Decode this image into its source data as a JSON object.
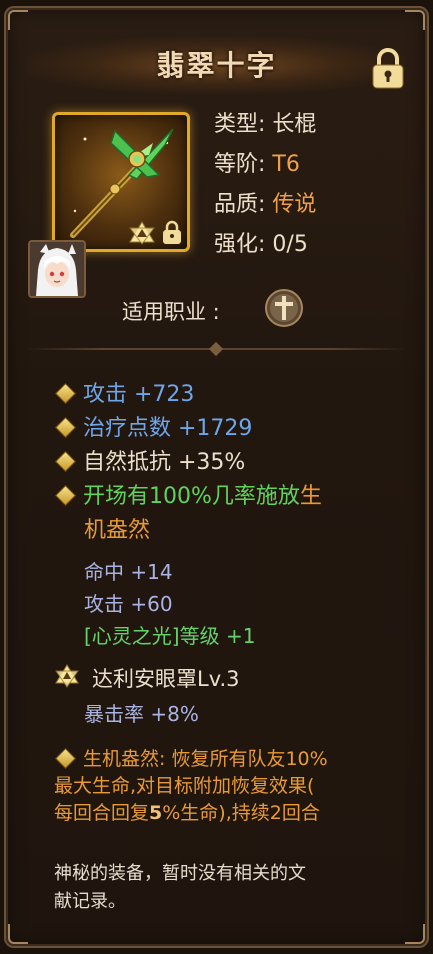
{
  "item": {
    "name": "翡翠十字",
    "type_label": "类型:",
    "type_value": "长棍",
    "tier_label": "等阶:",
    "tier_value": "T6",
    "quality_label": "品质:",
    "quality_value": "传说",
    "enhance_label": "强化:",
    "enhance_value": "0/5",
    "class_label": "适用职业 :",
    "class_icon": "priest-cross-icon"
  },
  "stats": {
    "attack": "攻击 +723",
    "heal_points": "治疗点数 +1729",
    "nature_resist": "自然抵抗 +35%",
    "proc_line1_prefix": "开场有100%几率施放",
    "proc_line1_suffix": "生",
    "proc_line2": "机盎然"
  },
  "substats": {
    "hit": "命中 +14",
    "attack": "攻击 +60",
    "skill": "[心灵之光]等级 +1"
  },
  "set": {
    "name": "达利安眼罩Lv.3",
    "bonus": "暴击率 +8%"
  },
  "effect": {
    "line1": "生机盎然: 恢复所有队友10%",
    "line2": "最大生命,对目标附加恢复效果(",
    "line3_pre": "每回合回复",
    "line3_num": "5",
    "line3_post": "%生命),持续2回合"
  },
  "description": {
    "line1": "神秘的装备，暂时没有相关的文",
    "line2": "献记录。"
  },
  "colors": {
    "frame_gold": "#e0a92a",
    "stat_blue": "#6fa6ea",
    "proc_green": "#5fd35c",
    "effect_orange": "#e99a36",
    "tier_orange": "#f0a04a"
  }
}
